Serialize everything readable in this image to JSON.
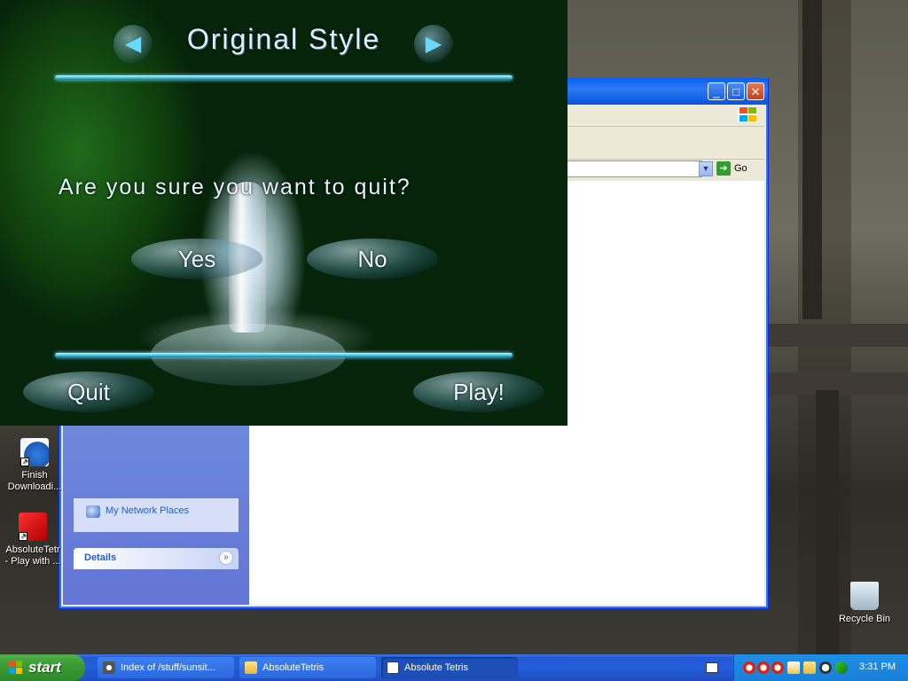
{
  "game": {
    "title": "Original Style",
    "question": "Are you sure you want to quit?",
    "yes_label": "Yes",
    "no_label": "No",
    "quit_label": "Quit",
    "play_label": "Play!",
    "prev_glyph": "◀",
    "next_glyph": "▶"
  },
  "explorer": {
    "go_label": "Go",
    "sidebar": {
      "network_places": "My Network Places",
      "details_header": "Details"
    }
  },
  "desktop": {
    "icons": [
      {
        "label": "Finish Downloadi...",
        "icon": "download-icon"
      },
      {
        "label": "AbsoluteTetr - Play with ...",
        "icon": "tetris-icon"
      },
      {
        "label": "Recycle Bin",
        "icon": "recycle-bin-icon"
      }
    ]
  },
  "taskbar": {
    "start_label": "start",
    "tasks": [
      {
        "label": "Index of /stuff/sunsit...",
        "icon": "browser-icon"
      },
      {
        "label": "AbsoluteTetris",
        "icon": "folder-icon"
      },
      {
        "label": "Absolute Tetris",
        "icon": "window-icon"
      }
    ],
    "clock": "3:31 PM"
  },
  "colors": {
    "taskbar_blue": "#245edb",
    "start_green": "#3c9b35",
    "xp_titlebar": "#0a5ff0",
    "game_accent": "#4cc8e6"
  }
}
